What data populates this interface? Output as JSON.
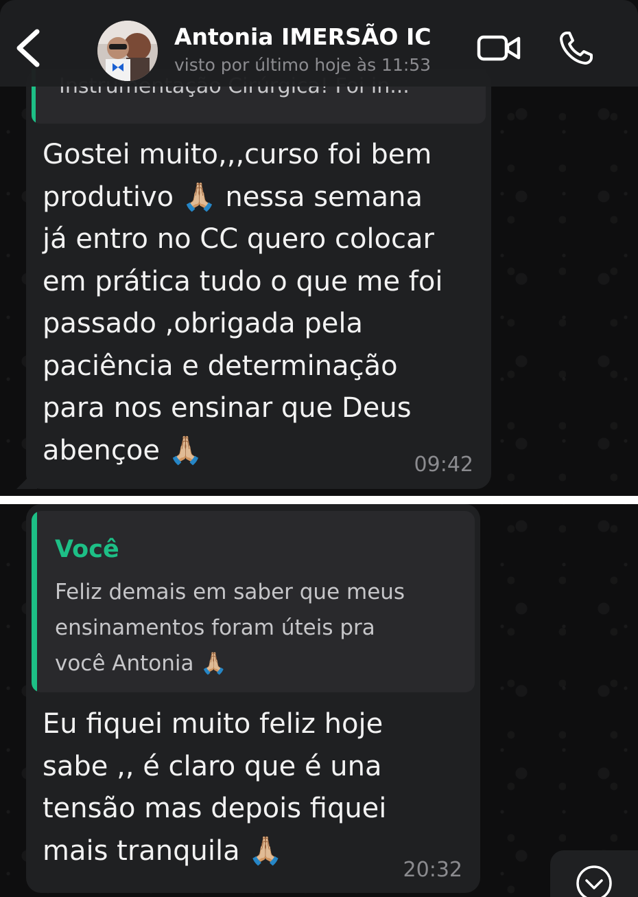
{
  "header": {
    "contact_name": "Antonia IMERSÃO IC",
    "last_seen": "visto por último hoje às 11:53",
    "icons": {
      "back": "chevron-left-icon",
      "video": "video-camera-icon",
      "call": "phone-icon"
    }
  },
  "messages": [
    {
      "quoted_text_cut": "Instrumentação Cirúrgica! Foi in...",
      "text": "Gostei muito,,,curso foi bem\nprodutivo 🙏🏼 nessa semana\njá entro no CC quero colocar\nem prática tudo o que me foi\npassado ,obrigada pela\npaciência e determinação\npara nos ensinar que Deus\nabençoe 🙏🏼",
      "time": "09:42"
    },
    {
      "quoted_author": "Você",
      "quoted_text": "Feliz demais em saber que meus\nensinamentos foram úteis pra\nvocê Antonia 🙏🏼",
      "text": "Eu fiquei muito feliz hoje\nsabe ,, é  claro que é una\ntensão mas depois fiquei\nmais tranquila 🙏🏼",
      "time": "20:32"
    }
  ],
  "colors": {
    "header_bg": "#1e1f21",
    "bubble_bg": "#1f2022",
    "quote_bg": "#29292c",
    "accent_green": "#1dbf86",
    "time_gray": "#8b8b8f"
  }
}
